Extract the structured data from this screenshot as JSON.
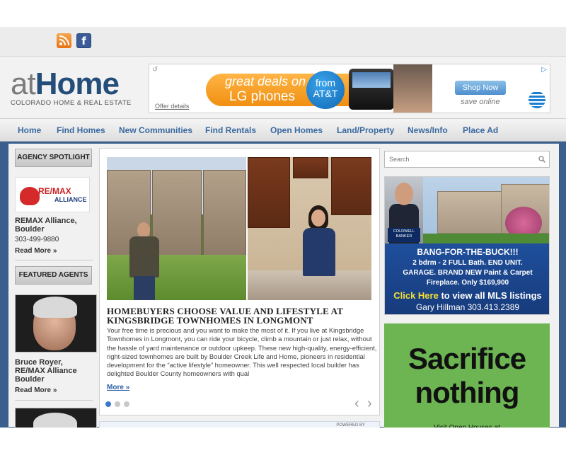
{
  "social": {
    "rss_icon": "rss-icon",
    "facebook_icon": "facebook-icon",
    "facebook_glyph": "f"
  },
  "logo": {
    "at": "at",
    "home": "Home",
    "tagline": "COLORADO HOME & REAL ESTATE"
  },
  "banner_ad": {
    "line1": "great deals on",
    "line2": "LG phones",
    "badge_from": "from",
    "badge_brand": "AT&T",
    "cta": "Shop Now",
    "subtext": "save online",
    "offer_details": "Offer details",
    "colors": {
      "pill": "#f08f11",
      "badge": "#1e7ec9"
    }
  },
  "nav": {
    "items": [
      {
        "label": "Home"
      },
      {
        "label": "Find Homes"
      },
      {
        "label": "New Communities"
      },
      {
        "label": "Find Rentals"
      },
      {
        "label": "Open Homes"
      },
      {
        "label": "Land/Property"
      },
      {
        "label": "News/Info"
      },
      {
        "label": "Place Ad"
      }
    ],
    "color": "#3a6aa0"
  },
  "sidebar": {
    "agency_header": "AGENCY SPOTLIGHT",
    "agency_logo_text": "RE/MAX",
    "agency_logo_sub": "ALLIANCE",
    "agency_name": "REMAX Alliance, Boulder",
    "agency_phone": "303-499-9880",
    "agency_more": "Read More »",
    "agents_header": "FEATURED AGENTS",
    "agent_name": "Bruce Royer, RE/MAX Alliance Boulder",
    "agent_more": "Read More »"
  },
  "feature": {
    "headline": "HOMEBUYERS CHOOSE VALUE AND LIFESTYLE AT KINGSBRIDGE TOWNHOMES IN LONGMONT",
    "body": "Your free time is precious and you want to make the most of it.  If you live at Kingsbridge Townhomes in Longmont, you can ride your bicycle, climb a mountain or just relax, without the hassle of yard maintenance or outdoor upkeep. These new high-quality, energy-efficient, right-sized townhomes are built by Boulder Creek Life and Home, pioneers in residential development for the “active lifestyle” homeowner. This well respected local builder has delighted Boulder County homeowners with qual",
    "more": "More »",
    "prev_arrow": "‹",
    "next_arrow": "›"
  },
  "powered_by": "POWERED BY",
  "search": {
    "placeholder": "Search"
  },
  "realtor_ad": {
    "badge": "COLDWELL BANKER",
    "line1": "BANG-FOR-THE-BUCK!!!",
    "line2": "2 bdrm - 2 FULL Bath. END UNIT.",
    "line3": "GARAGE. BRAND NEW Paint & Carpet",
    "line4": "Fireplace. Only $169,900",
    "click_here": "Click Here",
    "click_rest": " to view all MLS listings",
    "contact": "Gary Hillman 303.413.2389"
  },
  "sacrifice_ad": {
    "line1": "Sacrifice",
    "line2": "nothing",
    "line3": "Visit Open Houses at",
    "color": "#6cb552"
  }
}
